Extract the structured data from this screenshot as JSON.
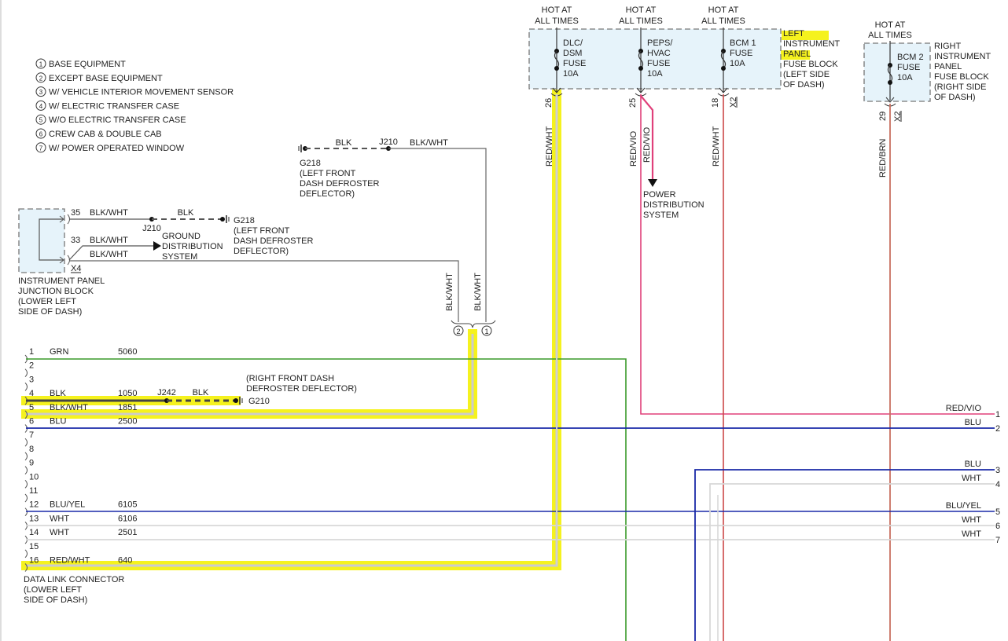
{
  "legend": [
    {
      "n": "1",
      "text": "BASE EQUIPMENT"
    },
    {
      "n": "2",
      "text": "EXCEPT BASE EQUIPMENT"
    },
    {
      "n": "3",
      "text": "W/ VEHICLE INTERIOR MOVEMENT SENSOR"
    },
    {
      "n": "4",
      "text": "W/ ELECTRIC TRANSFER CASE"
    },
    {
      "n": "5",
      "text": "W/O ELECTRIC TRANSFER CASE"
    },
    {
      "n": "6",
      "text": "CREW CAB & DOUBLE CAB"
    },
    {
      "n": "7",
      "text": "W/ POWER OPERATED WINDOW"
    }
  ],
  "hot": [
    "HOT AT",
    "ALL TIMES"
  ],
  "left_fuse_block": {
    "fuses": [
      {
        "lines": [
          "DLC/",
          "DSM",
          "FUSE",
          "10A"
        ],
        "pin": "26",
        "wire": "RED/WHT"
      },
      {
        "lines": [
          "PEPS/",
          "HVAC",
          "FUSE",
          "10A"
        ],
        "pin": "25",
        "wire": "RED/VIO"
      },
      {
        "lines": [
          "BCM 1",
          "FUSE",
          "10A"
        ],
        "pin": "18",
        "wire": "RED/WHT",
        "connector": "X2"
      }
    ],
    "label": [
      "LEFT",
      "INSTRUMENT",
      "PANEL",
      "FUSE BLOCK",
      "(LEFT SIDE",
      "OF DASH)"
    ],
    "branch_wire": "RED/VIO",
    "power_dist": [
      "POWER",
      "DISTRIBUTION",
      "SYSTEM"
    ]
  },
  "right_fuse_block": {
    "fuse": [
      "BCM 2",
      "FUSE",
      "10A"
    ],
    "pin": "29",
    "connector": "X2",
    "wire": "RED/BRN",
    "label": [
      "RIGHT",
      "INSTRUMENT",
      "PANEL",
      "FUSE BLOCK",
      "(RIGHT SIDE",
      "OF DASH)"
    ]
  },
  "top_ground": {
    "wire1": "BLK",
    "splice": "J210",
    "wire2": "BLK/WHT",
    "label": [
      "G218",
      "(LEFT FRONT",
      "DASH DEFROSTER",
      "DEFLECTOR)"
    ]
  },
  "junction_block": {
    "label": [
      "INSTRUMENT PANEL",
      "JUNCTION BLOCK",
      "(LOWER LEFT",
      "SIDE OF DASH)"
    ],
    "connector": "X4",
    "pin35": "35",
    "pin33": "33",
    "wire_a": "BLK/WHT",
    "wire_b": "BLK/WHT",
    "wire_c": "BLK/WHT",
    "splice": "J210",
    "wire_blk": "BLK",
    "ground_label": [
      "G218",
      "(LEFT FRONT",
      "DASH DEFROSTER",
      "DEFLECTOR)"
    ],
    "gnd_dist": [
      "GROUND",
      "DISTRIBUTION",
      "SYSTEM"
    ]
  },
  "vertical_blkwht": [
    "BLK/WHT",
    "BLK/WHT"
  ],
  "option_marks": [
    "2",
    "1"
  ],
  "dlc": {
    "label": [
      "DATA LINK CONNECTOR",
      "(LOWER LEFT",
      "SIDE OF DASH)"
    ],
    "pins": [
      {
        "n": "1",
        "color": "GRN",
        "circuit": "5060"
      },
      {
        "n": "2",
        "color": "",
        "circuit": ""
      },
      {
        "n": "3",
        "color": "",
        "circuit": ""
      },
      {
        "n": "4",
        "color": "BLK",
        "circuit": "1050"
      },
      {
        "n": "5",
        "color": "BLK/WHT",
        "circuit": "1851"
      },
      {
        "n": "6",
        "color": "BLU",
        "circuit": "2500"
      },
      {
        "n": "7",
        "color": "",
        "circuit": ""
      },
      {
        "n": "8",
        "color": "",
        "circuit": ""
      },
      {
        "n": "9",
        "color": "",
        "circuit": ""
      },
      {
        "n": "10",
        "color": "",
        "circuit": ""
      },
      {
        "n": "11",
        "color": "",
        "circuit": ""
      },
      {
        "n": "12",
        "color": "BLU/YEL",
        "circuit": "6105"
      },
      {
        "n": "13",
        "color": "WHT",
        "circuit": "6106"
      },
      {
        "n": "14",
        "color": "WHT",
        "circuit": "2501"
      },
      {
        "n": "15",
        "color": "",
        "circuit": ""
      },
      {
        "n": "16",
        "color": "RED/WHT",
        "circuit": "640"
      }
    ],
    "splice": "J242",
    "splice_wire": "BLK",
    "ground": "G210",
    "ground_label": [
      "(RIGHT FRONT DASH",
      "DEFROSTER DEFLECTOR)"
    ]
  },
  "right_outputs": [
    {
      "n": "1",
      "wire": "RED/VIO"
    },
    {
      "n": "2",
      "wire": "BLU"
    },
    {
      "n": "3",
      "wire": "BLU"
    },
    {
      "n": "4",
      "wire": "WHT"
    },
    {
      "n": "5",
      "wire": "BLU/YEL"
    },
    {
      "n": "6",
      "wire": "WHT"
    },
    {
      "n": "7",
      "wire": "WHT"
    }
  ],
  "colors": {
    "grn": "#3a9a2a",
    "blu": "#1a2aa8",
    "wht": "#d8d8d8",
    "redvio": "#e0407a",
    "redwht": "#cc4848",
    "redbrn": "#c87060",
    "highlight": "#f5f21e"
  }
}
